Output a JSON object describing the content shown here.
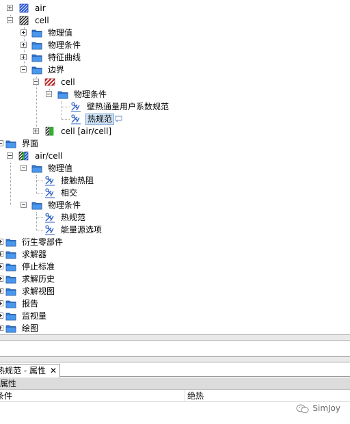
{
  "tree": {
    "air": "air",
    "cell": "cell",
    "physics_values": "物理值",
    "physics_conditions": "物理条件",
    "feature_curves": "特征曲线",
    "boundaries": "边界",
    "boundary_cell": "cell",
    "boundary_physics_conditions": "物理条件",
    "wall_heat_flux": "壁热通量用户系数规范",
    "thermal_spec": "热规范",
    "interface_boundary": "cell [air/cell]",
    "interfaces": "界面",
    "air_cell": "air/cell",
    "if_physics_values": "物理值",
    "contact_resistance": "接触热阻",
    "intersect": "相交",
    "if_physics_conditions": "物理条件",
    "if_thermal_spec": "热规范",
    "energy_source_options": "能量源选项",
    "derived_parts": "衍生零部件",
    "solvers": "求解器",
    "stopping_criteria": "停止标准",
    "solution_history": "求解历史",
    "solution_views": "求解视图",
    "reports": "报告",
    "monitors": "监视量",
    "plots": "绘图"
  },
  "properties": {
    "tab_title": "热规范 - 属性",
    "tab_close": "✕",
    "header": "属性",
    "row_name": "条件",
    "row_value": "绝热"
  },
  "watermark": "SimJoy",
  "colors": {
    "folder": "#2f7ad9",
    "selection": "#cfe3f6",
    "selection_border": "#7da2ce"
  }
}
